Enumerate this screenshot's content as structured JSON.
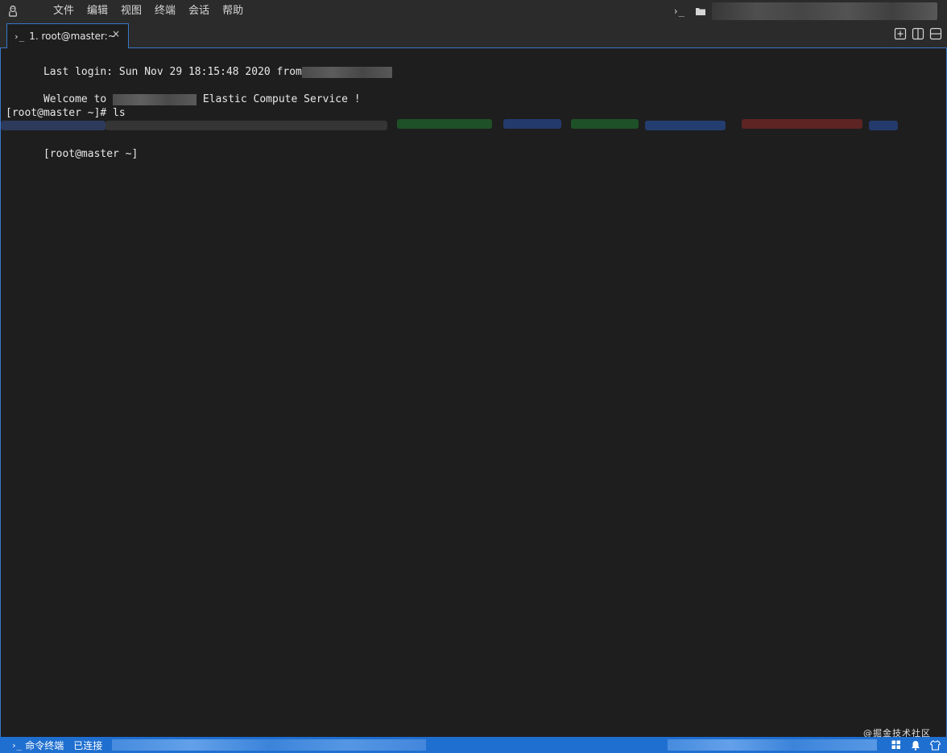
{
  "menubar": {
    "items": [
      "文件",
      "编辑",
      "视图",
      "终端",
      "会话",
      "帮助"
    ],
    "right_prompt": "›_"
  },
  "tab": {
    "prompt": "›_",
    "label": "1. root@master:~",
    "close": "×"
  },
  "terminal": {
    "line1": "Last login: Sun Nov 29 18:15:48 2020 from",
    "line2_prefix": "Welcome to",
    "line2_suffix": "Elastic Compute Service !",
    "line3": "[root@master ~]# ls",
    "line5": "[root@master ~]"
  },
  "statusbar": {
    "prompt": "›_",
    "terminal_label": "命令终端",
    "connection": "已连接"
  },
  "watermark": "@掘金技术社区",
  "colors": {
    "accent": "#3a78c8",
    "statusbar": "#1f6fd0",
    "background": "#1e1e1e",
    "menubar": "#2b2b2b"
  }
}
